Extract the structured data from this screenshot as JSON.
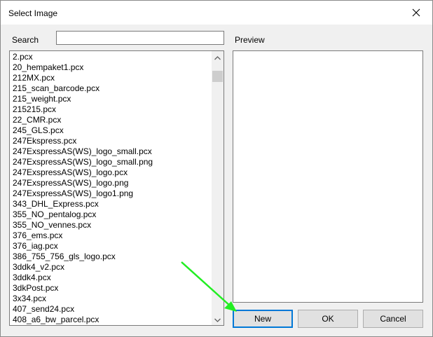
{
  "window": {
    "title": "Select Image"
  },
  "search": {
    "label": "Search",
    "value": "",
    "placeholder": ""
  },
  "preview": {
    "label": "Preview"
  },
  "file_list": {
    "items": [
      "2.pcx",
      "20_hempaket1.pcx",
      "212MX.pcx",
      "215_scan_barcode.pcx",
      "215_weight.pcx",
      "215215.pcx",
      "22_CMR.pcx",
      "245_GLS.pcx",
      "247Ekspress.pcx",
      "247ExspressAS(WS)_logo_small.pcx",
      "247ExspressAS(WS)_logo_small.png",
      "247ExspressAS(WS)_logo.pcx",
      "247ExspressAS(WS)_logo.png",
      "247ExspressAS(WS)_logo1.png",
      "343_DHL_Express.pcx",
      "355_NO_pentalog.pcx",
      "355_NO_vennes.pcx",
      "376_ems.pcx",
      "376_iag.pcx",
      "386_755_756_gls_logo.pcx",
      "3ddk4_v2.pcx",
      "3ddk4.pcx",
      "3dkPost.pcx",
      "3x34.pcx",
      "407_send24.pcx",
      "408_a6_bw_parcel.pcx"
    ]
  },
  "buttons": {
    "new": "New",
    "ok": "OK",
    "cancel": "Cancel"
  },
  "icons": {
    "close": "close-icon",
    "scroll_up": "chevron-up-icon",
    "scroll_down": "chevron-down-icon",
    "annotation": "arrow-icon"
  },
  "colors": {
    "focus_border": "#0078d7",
    "annotation_arrow": "#22ee22",
    "dialog_bg": "#f0f0f0"
  }
}
